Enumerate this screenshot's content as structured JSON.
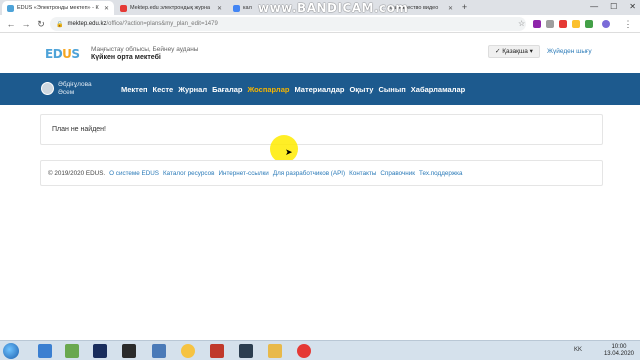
{
  "browser": {
    "tabs": [
      {
        "label": "EDUS «Электронды мектеп» - К",
        "active": true,
        "fav_color": "#4ea3d8"
      },
      {
        "label": "Mektep.edu электрондық журна",
        "active": false,
        "fav_color": "#e53935"
      },
      {
        "label": "кал",
        "active": false,
        "fav_color": "#4285f4"
      },
      {
        "label": "ешь качество видео",
        "active": false,
        "fav_color": "#4285f4"
      }
    ],
    "watermark": "www.BANDICAM.com",
    "window_buttons": [
      "—",
      "☐",
      "✕"
    ],
    "url_host": "mektep.edu.kz",
    "url_path": "/office/?action=plans&my_plan_edit=1479"
  },
  "header": {
    "logo_main": "ED",
    "logo_accent": "U",
    "logo_end": "S",
    "region": "Маңғыстау облысы, Бейнеу ауданы",
    "school": "Күйкен орта мектебі",
    "language": "✓ Қазақша ▾",
    "logout": "Жүйеден шығу"
  },
  "nav": {
    "user_first": "Әбдіғұлова",
    "user_last": "Әсем",
    "items": [
      "Мектеп",
      "Кесте",
      "Журнал",
      "Бағалар",
      "Жоспарлар",
      "Материалдар",
      "Оқыту",
      "Сынып",
      "Хабарламалар"
    ],
    "active_index": 4
  },
  "content": {
    "empty_message": "План не найден!"
  },
  "footer": {
    "copyright": "© 2019/2020 EDUS.",
    "links": [
      "О системе EDUS",
      "Каталог ресурсов",
      "Интернет-ссылки",
      "Для разработчиков (API)",
      "Контакты",
      "Справочник",
      "Тех.поддержка"
    ]
  },
  "taskbar": {
    "lang": "KK",
    "time": "10:00",
    "date": "13.04.2020"
  },
  "colors": {
    "nav_bg": "#1d5a8e",
    "nav_active": "#f5b400",
    "link": "#2a7ab8"
  }
}
